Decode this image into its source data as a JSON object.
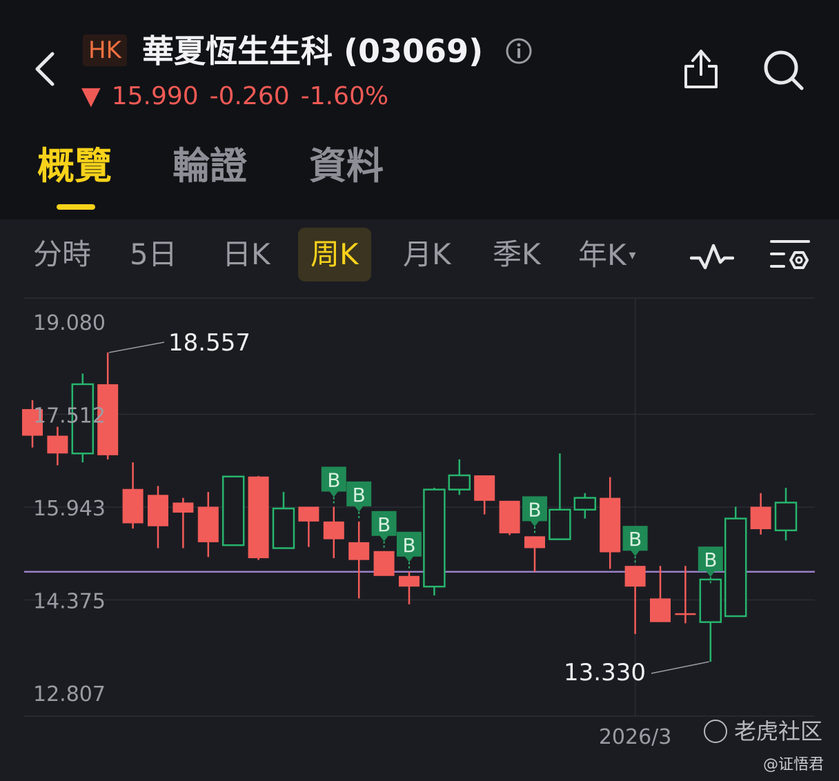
{
  "header": {
    "market_badge": "HK",
    "stock_name": "華夏恆生生科 (03069)",
    "price": "15.990",
    "change": "-0.260",
    "change_pct": "-1.60%",
    "down_arrow": "▼",
    "price_color": "#f05a55"
  },
  "tabs": [
    {
      "label": "概覽",
      "active": true
    },
    {
      "label": "輪證",
      "active": false
    },
    {
      "label": "資料",
      "active": false
    }
  ],
  "periods": [
    {
      "label": "分時",
      "active": false
    },
    {
      "label": "5日",
      "active": false
    },
    {
      "label": "日K",
      "active": false
    },
    {
      "label": "周K",
      "active": true
    },
    {
      "label": "月K",
      "active": false
    },
    {
      "label": "季K",
      "active": false
    },
    {
      "label": "年K",
      "active": false
    }
  ],
  "icons": {
    "back": "chevron-left-icon",
    "info": "info-icon",
    "share": "share-icon",
    "search": "search-icon",
    "indicator": "indicator-line-icon",
    "settings": "chart-settings-icon",
    "dropdown": "▾"
  },
  "chart_data": {
    "type": "candlestick",
    "period": "weekly",
    "y_ticks": [
      "19.080",
      "17.512",
      "15.943",
      "14.375",
      "12.807"
    ],
    "ylim": [
      12.807,
      19.08
    ],
    "x_ticks": [
      {
        "label": "2026/3",
        "index": 24
      }
    ],
    "reference_line": 14.85,
    "annotations": [
      {
        "text": "18.557",
        "type": "high",
        "index": 3
      },
      {
        "text": "13.330",
        "type": "low",
        "index": 27
      }
    ],
    "colors": {
      "up": "#27b56d",
      "down": "#f25c58",
      "reference": "#9b7fc7",
      "b_marker": "#1f8a55"
    },
    "b_label": "B",
    "candles": [
      {
        "o": 17.6,
        "h": 17.75,
        "l": 16.95,
        "c": 17.15
      },
      {
        "o": 17.15,
        "h": 17.3,
        "l": 16.65,
        "c": 16.85
      },
      {
        "o": 16.85,
        "h": 18.2,
        "l": 16.7,
        "c": 18.02
      },
      {
        "o": 18.02,
        "h": 18.557,
        "l": 16.75,
        "c": 16.82
      },
      {
        "o": 16.25,
        "h": 16.7,
        "l": 15.58,
        "c": 15.67
      },
      {
        "o": 16.15,
        "h": 16.3,
        "l": 15.25,
        "c": 15.62
      },
      {
        "o": 16.02,
        "h": 16.1,
        "l": 15.25,
        "c": 15.85
      },
      {
        "o": 15.95,
        "h": 16.2,
        "l": 15.1,
        "c": 15.35
      },
      {
        "o": 15.3,
        "h": 16.45,
        "l": 15.3,
        "c": 16.46
      },
      {
        "o": 16.46,
        "h": 16.47,
        "l": 15.05,
        "c": 15.08
      },
      {
        "o": 15.25,
        "h": 16.2,
        "l": 15.25,
        "c": 15.92
      },
      {
        "o": 15.95,
        "h": 15.95,
        "l": 15.27,
        "c": 15.7
      },
      {
        "o": 15.7,
        "h": 15.95,
        "l": 15.08,
        "c": 15.4
      },
      {
        "o": 15.35,
        "h": 15.7,
        "l": 14.4,
        "c": 15.05
      },
      {
        "o": 15.2,
        "h": 15.2,
        "l": 14.8,
        "c": 14.78
      },
      {
        "o": 14.78,
        "h": 14.85,
        "l": 14.3,
        "c": 14.6
      },
      {
        "o": 14.6,
        "h": 16.27,
        "l": 14.45,
        "c": 16.24
      },
      {
        "o": 16.24,
        "h": 16.75,
        "l": 16.15,
        "c": 16.48
      },
      {
        "o": 16.48,
        "h": 16.48,
        "l": 15.82,
        "c": 16.05
      },
      {
        "o": 16.05,
        "h": 16.05,
        "l": 15.47,
        "c": 15.5
      },
      {
        "o": 15.45,
        "h": 15.45,
        "l": 14.85,
        "c": 15.25
      },
      {
        "o": 15.4,
        "h": 16.85,
        "l": 15.4,
        "c": 15.9
      },
      {
        "o": 15.9,
        "h": 16.18,
        "l": 15.75,
        "c": 16.1
      },
      {
        "o": 16.1,
        "h": 16.45,
        "l": 14.9,
        "c": 15.18
      },
      {
        "o": 14.95,
        "h": 14.95,
        "l": 13.8,
        "c": 14.6
      },
      {
        "o": 14.4,
        "h": 14.95,
        "l": 14.0,
        "c": 14.0
      },
      {
        "o": 14.15,
        "h": 14.95,
        "l": 13.98,
        "c": 14.12
      },
      {
        "o": 14.0,
        "h": 14.6,
        "l": 13.33,
        "c": 14.72
      },
      {
        "o": 14.1,
        "h": 15.95,
        "l": 14.1,
        "c": 15.75
      },
      {
        "o": 15.95,
        "h": 16.18,
        "l": 15.48,
        "c": 15.57
      },
      {
        "o": 15.55,
        "h": 16.27,
        "l": 15.38,
        "c": 16.02
      }
    ],
    "b_markers": [
      12,
      13,
      14,
      15,
      20,
      24,
      27
    ]
  },
  "watermark": {
    "text": "老虎社区",
    "credit": "@证悟君"
  }
}
